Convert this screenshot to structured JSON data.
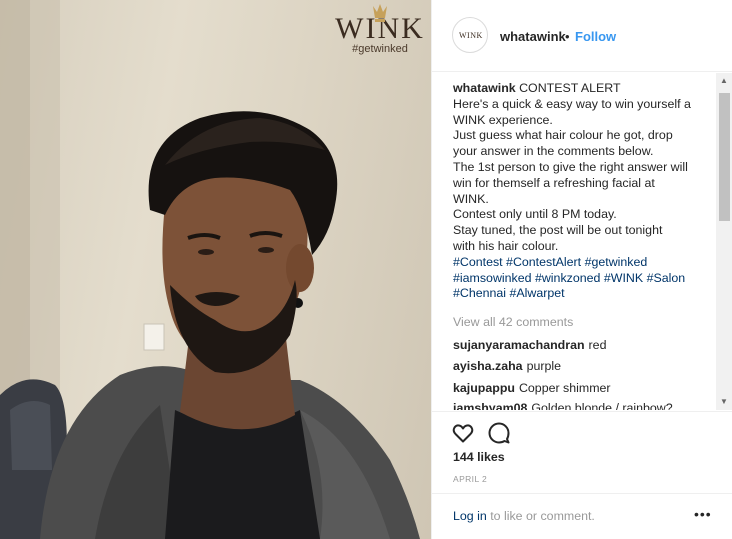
{
  "photo": {
    "watermark_word": "WINK",
    "watermark_tag": "#getwinked"
  },
  "header": {
    "avatar_text": "WINK",
    "username": "whatawink",
    "separator": "•",
    "follow_label": "Follow"
  },
  "caption": {
    "username": "whatawink",
    "lines": [
      "CONTEST ALERT",
      "Here's a quick & easy way to win yourself a",
      "WINK experience.",
      "Just guess what hair colour he got, drop",
      "your answer in the comments below.",
      "The 1st person to give the right answer will",
      "win for themself a refreshing facial at",
      "WINK.",
      "Contest only until 8 PM today.",
      "Stay tuned, the post will be out tonight",
      "with his hair colour."
    ],
    "hashtag_lines": [
      [
        "#Contest",
        "#ContestAlert",
        "#getwinked"
      ],
      [
        "#iamsowinked",
        "#winkzoned",
        "#WINK",
        "#Salon"
      ],
      [
        "#Chennai",
        "#Alwarpet"
      ]
    ]
  },
  "comments": {
    "view_all": "View all 42 comments",
    "items": [
      {
        "user": "sujanyaramachandran",
        "text": "red"
      },
      {
        "user": "ayisha.zaha",
        "text": "purple"
      },
      {
        "user": "kajupappu",
        "text": "Copper shimmer"
      },
      {
        "user": "jamshyam08",
        "text": "Golden blonde / rainbow?"
      }
    ]
  },
  "actions": {
    "like_icon": "heart-icon",
    "comment_icon": "comment-bubble-icon",
    "likes": "144 likes",
    "date": "APRIL 2"
  },
  "footer": {
    "login_link": "Log in",
    "login_rest": " to like or comment.",
    "more_icon": "more-options-icon",
    "more_glyph": "•••"
  },
  "colors": {
    "link_blue": "#3897f0",
    "hashtag": "#003569",
    "muted": "#999999",
    "text": "#262626"
  }
}
